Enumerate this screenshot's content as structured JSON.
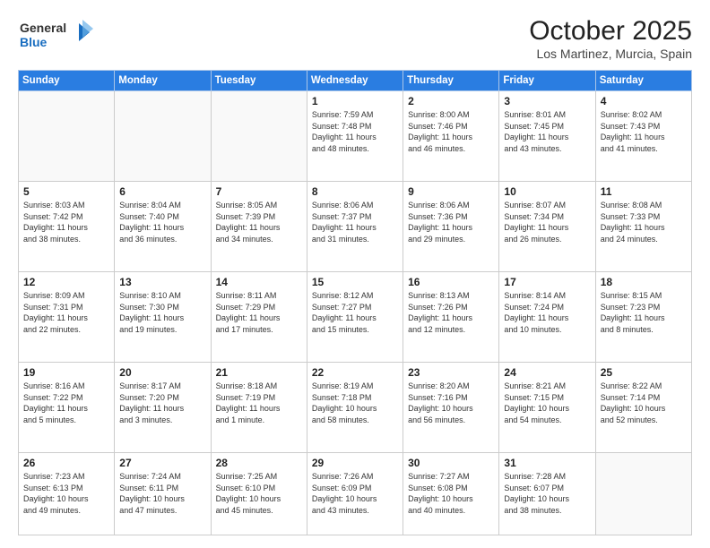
{
  "header": {
    "logo_line1": "General",
    "logo_line2": "Blue",
    "month_year": "October 2025",
    "location": "Los Martinez, Murcia, Spain"
  },
  "days_of_week": [
    "Sunday",
    "Monday",
    "Tuesday",
    "Wednesday",
    "Thursday",
    "Friday",
    "Saturday"
  ],
  "weeks": [
    [
      {
        "day": "",
        "detail": ""
      },
      {
        "day": "",
        "detail": ""
      },
      {
        "day": "",
        "detail": ""
      },
      {
        "day": "1",
        "detail": "Sunrise: 7:59 AM\nSunset: 7:48 PM\nDaylight: 11 hours\nand 48 minutes."
      },
      {
        "day": "2",
        "detail": "Sunrise: 8:00 AM\nSunset: 7:46 PM\nDaylight: 11 hours\nand 46 minutes."
      },
      {
        "day": "3",
        "detail": "Sunrise: 8:01 AM\nSunset: 7:45 PM\nDaylight: 11 hours\nand 43 minutes."
      },
      {
        "day": "4",
        "detail": "Sunrise: 8:02 AM\nSunset: 7:43 PM\nDaylight: 11 hours\nand 41 minutes."
      }
    ],
    [
      {
        "day": "5",
        "detail": "Sunrise: 8:03 AM\nSunset: 7:42 PM\nDaylight: 11 hours\nand 38 minutes."
      },
      {
        "day": "6",
        "detail": "Sunrise: 8:04 AM\nSunset: 7:40 PM\nDaylight: 11 hours\nand 36 minutes."
      },
      {
        "day": "7",
        "detail": "Sunrise: 8:05 AM\nSunset: 7:39 PM\nDaylight: 11 hours\nand 34 minutes."
      },
      {
        "day": "8",
        "detail": "Sunrise: 8:06 AM\nSunset: 7:37 PM\nDaylight: 11 hours\nand 31 minutes."
      },
      {
        "day": "9",
        "detail": "Sunrise: 8:06 AM\nSunset: 7:36 PM\nDaylight: 11 hours\nand 29 minutes."
      },
      {
        "day": "10",
        "detail": "Sunrise: 8:07 AM\nSunset: 7:34 PM\nDaylight: 11 hours\nand 26 minutes."
      },
      {
        "day": "11",
        "detail": "Sunrise: 8:08 AM\nSunset: 7:33 PM\nDaylight: 11 hours\nand 24 minutes."
      }
    ],
    [
      {
        "day": "12",
        "detail": "Sunrise: 8:09 AM\nSunset: 7:31 PM\nDaylight: 11 hours\nand 22 minutes."
      },
      {
        "day": "13",
        "detail": "Sunrise: 8:10 AM\nSunset: 7:30 PM\nDaylight: 11 hours\nand 19 minutes."
      },
      {
        "day": "14",
        "detail": "Sunrise: 8:11 AM\nSunset: 7:29 PM\nDaylight: 11 hours\nand 17 minutes."
      },
      {
        "day": "15",
        "detail": "Sunrise: 8:12 AM\nSunset: 7:27 PM\nDaylight: 11 hours\nand 15 minutes."
      },
      {
        "day": "16",
        "detail": "Sunrise: 8:13 AM\nSunset: 7:26 PM\nDaylight: 11 hours\nand 12 minutes."
      },
      {
        "day": "17",
        "detail": "Sunrise: 8:14 AM\nSunset: 7:24 PM\nDaylight: 11 hours\nand 10 minutes."
      },
      {
        "day": "18",
        "detail": "Sunrise: 8:15 AM\nSunset: 7:23 PM\nDaylight: 11 hours\nand 8 minutes."
      }
    ],
    [
      {
        "day": "19",
        "detail": "Sunrise: 8:16 AM\nSunset: 7:22 PM\nDaylight: 11 hours\nand 5 minutes."
      },
      {
        "day": "20",
        "detail": "Sunrise: 8:17 AM\nSunset: 7:20 PM\nDaylight: 11 hours\nand 3 minutes."
      },
      {
        "day": "21",
        "detail": "Sunrise: 8:18 AM\nSunset: 7:19 PM\nDaylight: 11 hours\nand 1 minute."
      },
      {
        "day": "22",
        "detail": "Sunrise: 8:19 AM\nSunset: 7:18 PM\nDaylight: 10 hours\nand 58 minutes."
      },
      {
        "day": "23",
        "detail": "Sunrise: 8:20 AM\nSunset: 7:16 PM\nDaylight: 10 hours\nand 56 minutes."
      },
      {
        "day": "24",
        "detail": "Sunrise: 8:21 AM\nSunset: 7:15 PM\nDaylight: 10 hours\nand 54 minutes."
      },
      {
        "day": "25",
        "detail": "Sunrise: 8:22 AM\nSunset: 7:14 PM\nDaylight: 10 hours\nand 52 minutes."
      }
    ],
    [
      {
        "day": "26",
        "detail": "Sunrise: 7:23 AM\nSunset: 6:13 PM\nDaylight: 10 hours\nand 49 minutes."
      },
      {
        "day": "27",
        "detail": "Sunrise: 7:24 AM\nSunset: 6:11 PM\nDaylight: 10 hours\nand 47 minutes."
      },
      {
        "day": "28",
        "detail": "Sunrise: 7:25 AM\nSunset: 6:10 PM\nDaylight: 10 hours\nand 45 minutes."
      },
      {
        "day": "29",
        "detail": "Sunrise: 7:26 AM\nSunset: 6:09 PM\nDaylight: 10 hours\nand 43 minutes."
      },
      {
        "day": "30",
        "detail": "Sunrise: 7:27 AM\nSunset: 6:08 PM\nDaylight: 10 hours\nand 40 minutes."
      },
      {
        "day": "31",
        "detail": "Sunrise: 7:28 AM\nSunset: 6:07 PM\nDaylight: 10 hours\nand 38 minutes."
      },
      {
        "day": "",
        "detail": ""
      }
    ]
  ]
}
